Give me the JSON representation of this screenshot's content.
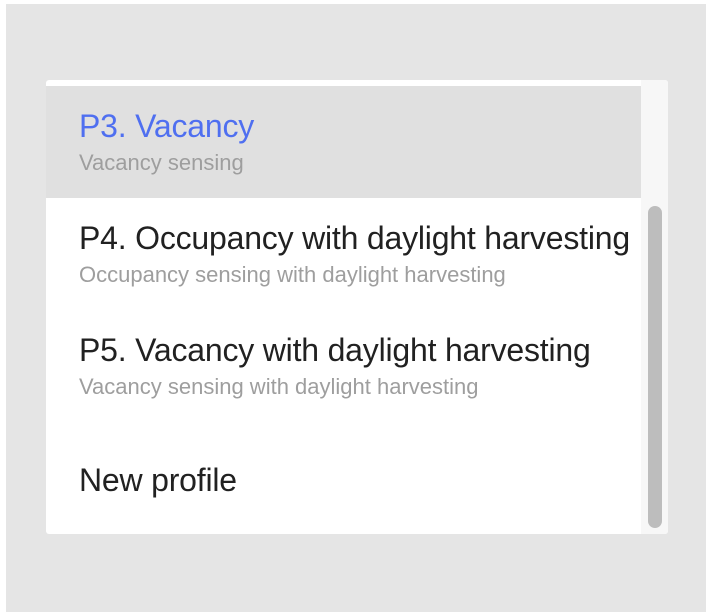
{
  "dropdown": {
    "items": [
      {
        "title": "P3. Vacancy",
        "subtitle": "Vacancy sensing",
        "selected": true
      },
      {
        "title": "P4. Occupancy with daylight harvesting",
        "subtitle": "Occupancy sensing with daylight harvesting",
        "selected": false
      },
      {
        "title": "P5. Vacancy with daylight harvesting",
        "subtitle": "Vacancy sensing with daylight harvesting",
        "selected": false
      },
      {
        "title": "New profile",
        "selected": false
      }
    ],
    "colors": {
      "selected_text": "#4f6ff0",
      "selected_background": "#e0e0e0",
      "primary_text": "#212121",
      "secondary_text": "#9e9e9e"
    }
  }
}
